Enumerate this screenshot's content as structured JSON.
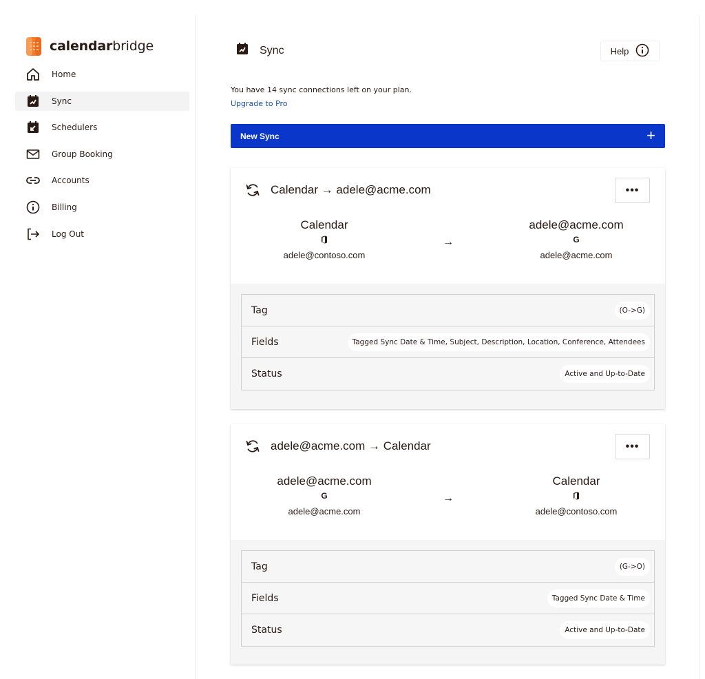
{
  "app": {
    "logo_bold": "calendar",
    "logo_light": "bridge"
  },
  "sidebar": {
    "items": [
      {
        "label": "Home",
        "icon": "home-icon"
      },
      {
        "label": "Sync",
        "icon": "sync-calendar-icon",
        "active": true
      },
      {
        "label": "Schedulers",
        "icon": "scheduler-icon"
      },
      {
        "label": "Group Booking",
        "icon": "mail-icon"
      },
      {
        "label": "Accounts",
        "icon": "link-icon"
      },
      {
        "label": "Billing",
        "icon": "info-icon"
      },
      {
        "label": "Log Out",
        "icon": "logout-icon"
      }
    ]
  },
  "header": {
    "title": "Sync",
    "help_label": "Help"
  },
  "plan": {
    "text": "You have 14 sync connections left on your plan.",
    "upgrade_label": "Upgrade to Pro"
  },
  "new_sync": {
    "label": "New Sync",
    "plus": "+"
  },
  "syncs": [
    {
      "title": "Calendar → adele@acme.com",
      "source": {
        "name": "Calendar",
        "provider_icon": "office-icon",
        "email": "adele@contoso.com"
      },
      "arrow": "→",
      "target": {
        "name": "adele@acme.com",
        "provider_icon": "google-icon",
        "email": "adele@acme.com"
      },
      "rows": [
        {
          "label": "Tag",
          "value": "(O->G)"
        },
        {
          "label": "Fields",
          "value": "Tagged Sync Date & Time, Subject, Description, Location, Conference, Attendees"
        },
        {
          "label": "Status",
          "value": "Active and Up-to-Date"
        }
      ]
    },
    {
      "title": "adele@acme.com → Calendar",
      "source": {
        "name": "adele@acme.com",
        "provider_icon": "google-icon",
        "email": "adele@acme.com"
      },
      "arrow": "→",
      "target": {
        "name": "Calendar",
        "provider_icon": "office-icon",
        "email": "adele@contoso.com"
      },
      "rows": [
        {
          "label": "Tag",
          "value": "(G->O)"
        },
        {
          "label": "Fields",
          "value": "Tagged Sync Date & Time"
        },
        {
          "label": "Status",
          "value": "Active and Up-to-Date"
        }
      ]
    }
  ],
  "more_label": "•••",
  "google_glyph": "G",
  "colors": {
    "primary": "#0a36c9",
    "link": "#1b4fa6",
    "logo": "#f47a2c",
    "text": "#2a1a14"
  }
}
